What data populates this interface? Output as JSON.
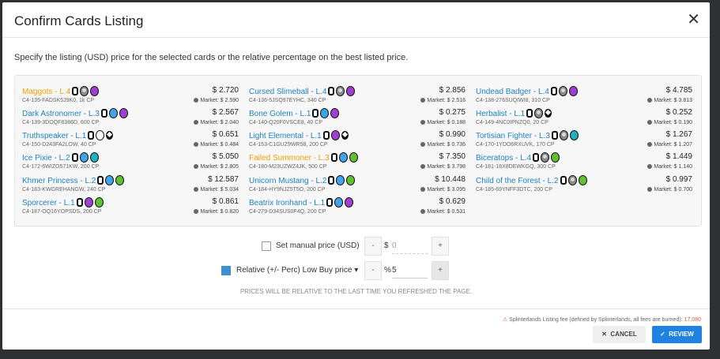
{
  "title": "Confirm Cards Listing",
  "instructions": "Specify the listing (USD) price for the selected cards or the relative percentage on the best listed price.",
  "cards": [
    {
      "name": "Maggots - L.4",
      "gold": true,
      "id": "C4-135-FADSK5J9K0, 1k CP",
      "price": "$ 2.720",
      "market": "Market: $ 2.590",
      "icons": [
        "ed",
        "rar",
        "pur"
      ]
    },
    {
      "name": "Cursed Slimeball - L.4",
      "gold": false,
      "id": "C4-136-5JSQ97EYHC, 340 CP",
      "price": "$ 2.856",
      "market": "Market: $ 2.516",
      "icons": [
        "ed",
        "rar",
        "pur"
      ]
    },
    {
      "name": "Undead Badger - L.4",
      "gold": false,
      "id": "C4-138-276SUQIWI8, 310 CP",
      "price": "$ 4.785",
      "market": "Market: $ 3.813",
      "icons": [
        "ed",
        "rar",
        "pur"
      ]
    },
    {
      "name": "Dark Astronomer - L.3",
      "gold": false,
      "id": "C4-139-3DOQF8386D, 600 CP",
      "price": "$ 2.567",
      "market": "Market: $ 2.040",
      "icons": [
        "ed",
        "blu",
        "pur"
      ]
    },
    {
      "name": "Bone Golem - L.1",
      "gold": false,
      "id": "C4-140-Q20F0VSCE8, 40 CP",
      "price": "$ 0.275",
      "market": "Market: $ 0.188",
      "icons": [
        "ed",
        "blu",
        "pur"
      ]
    },
    {
      "name": "Herbalist - L.1",
      "gold": false,
      "id": "C4-149-4NC0IPNZQ0, 20 CP",
      "price": "$ 0.252",
      "market": "Market: $ 0.190",
      "icons": [
        "ed",
        "rar",
        "dia"
      ]
    },
    {
      "name": "Truthspeaker - L.1",
      "gold": false,
      "id": "C4-150-D243FA2LOW, 40 CP",
      "price": "$ 0.651",
      "market": "Market: $ 0.484",
      "icons": [
        "ed",
        "wht",
        "dia"
      ]
    },
    {
      "name": "Light Elemental - L.1",
      "gold": false,
      "id": "C4-153-C1GUZ9WR58, 200 CP",
      "price": "$ 0.990",
      "market": "Market: $ 0.736",
      "icons": [
        "ed",
        "pur",
        "dia"
      ]
    },
    {
      "name": "Tortisian Fighter - L.3",
      "gold": false,
      "id": "C4-170-1YDO6RXUVK, 170 CP",
      "price": "$ 1.267",
      "market": "Market: $ 1.207",
      "icons": [
        "ed",
        "rar",
        "tea"
      ]
    },
    {
      "name": "Ice Pixie - L.2",
      "gold": false,
      "id": "C4-172-6WIZO571KW, 200 CP",
      "price": "$ 5.050",
      "market": "Market: $ 2.805",
      "icons": [
        "ed",
        "blu",
        "tea"
      ]
    },
    {
      "name": "Failed Summoner - L.3",
      "gold": true,
      "id": "C4-180-M23UZWZ4JK, 500 CP",
      "price": "$ 7.350",
      "market": "Market: $ 3.798",
      "icons": [
        "ed",
        "blu",
        "grn"
      ]
    },
    {
      "name": "Biceratops - L.4",
      "gold": false,
      "id": "C4-181-18X8DEWKGQ, 300 CP",
      "price": "$ 1.449",
      "market": "Market: $ 1.140",
      "icons": [
        "ed",
        "rar",
        "grn"
      ]
    },
    {
      "name": "Khmer Princess - L.2",
      "gold": false,
      "id": "C4-183-KWGREHANGW, 240 CP",
      "price": "$ 12.587",
      "market": "Market: $ 5.034",
      "icons": [
        "ed",
        "blu",
        "grn"
      ]
    },
    {
      "name": "Unicorn Mustang - L.2",
      "gold": false,
      "id": "C4-184-HY9NJZ5T5O, 200 CP",
      "price": "$ 10.448",
      "market": "Market: $ 3.095",
      "icons": [
        "ed",
        "blu",
        "grn"
      ]
    },
    {
      "name": "Child of the Forest - L.2",
      "gold": false,
      "id": "C4-185-69YNFF3DTC, 200 CP",
      "price": "$ 0.997",
      "market": "Market: $ 0.700",
      "icons": [
        "ed",
        "rar",
        "grn"
      ]
    },
    {
      "name": "Sporcerer - L.1",
      "gold": false,
      "id": "C4-187-OQ16YOPSDS, 200 CP",
      "price": "$ 0.861",
      "market": "Market: $ 0.820",
      "icons": [
        "ed",
        "pur",
        "grn"
      ]
    },
    {
      "name": "Beatrix Ironhand - L.1",
      "gold": false,
      "id": "C4-279-D34SUS0F4Q, 200 CP",
      "price": "$ 0.629",
      "market": "Market: $ 0.531",
      "icons": [
        "ed",
        "blu",
        "pur"
      ]
    }
  ],
  "manual": {
    "label": "Set manual price (USD)",
    "currency": "$",
    "value": "0",
    "minus": "-",
    "plus": "+"
  },
  "relative": {
    "label": "Relative (+/- Perc) Low Buy price",
    "percent_sign": "%",
    "value": "5",
    "minus": "-",
    "plus": "+"
  },
  "note": "PRICES WILL BE RELATIVE TO THE LAST TIME YOU REFRESHED THE PAGE.",
  "fee": {
    "text": "Splinterlands Listing fee (defined by Splinterlands, all fees are burned):",
    "amount": "17.080"
  },
  "buttons": {
    "cancel": "CANCEL",
    "review": "REVIEW"
  },
  "colors": {
    "link": "#1f82c0",
    "gold": "#f0a000",
    "primary": "#1f82e0",
    "checkbox": "#3f8fd0"
  }
}
